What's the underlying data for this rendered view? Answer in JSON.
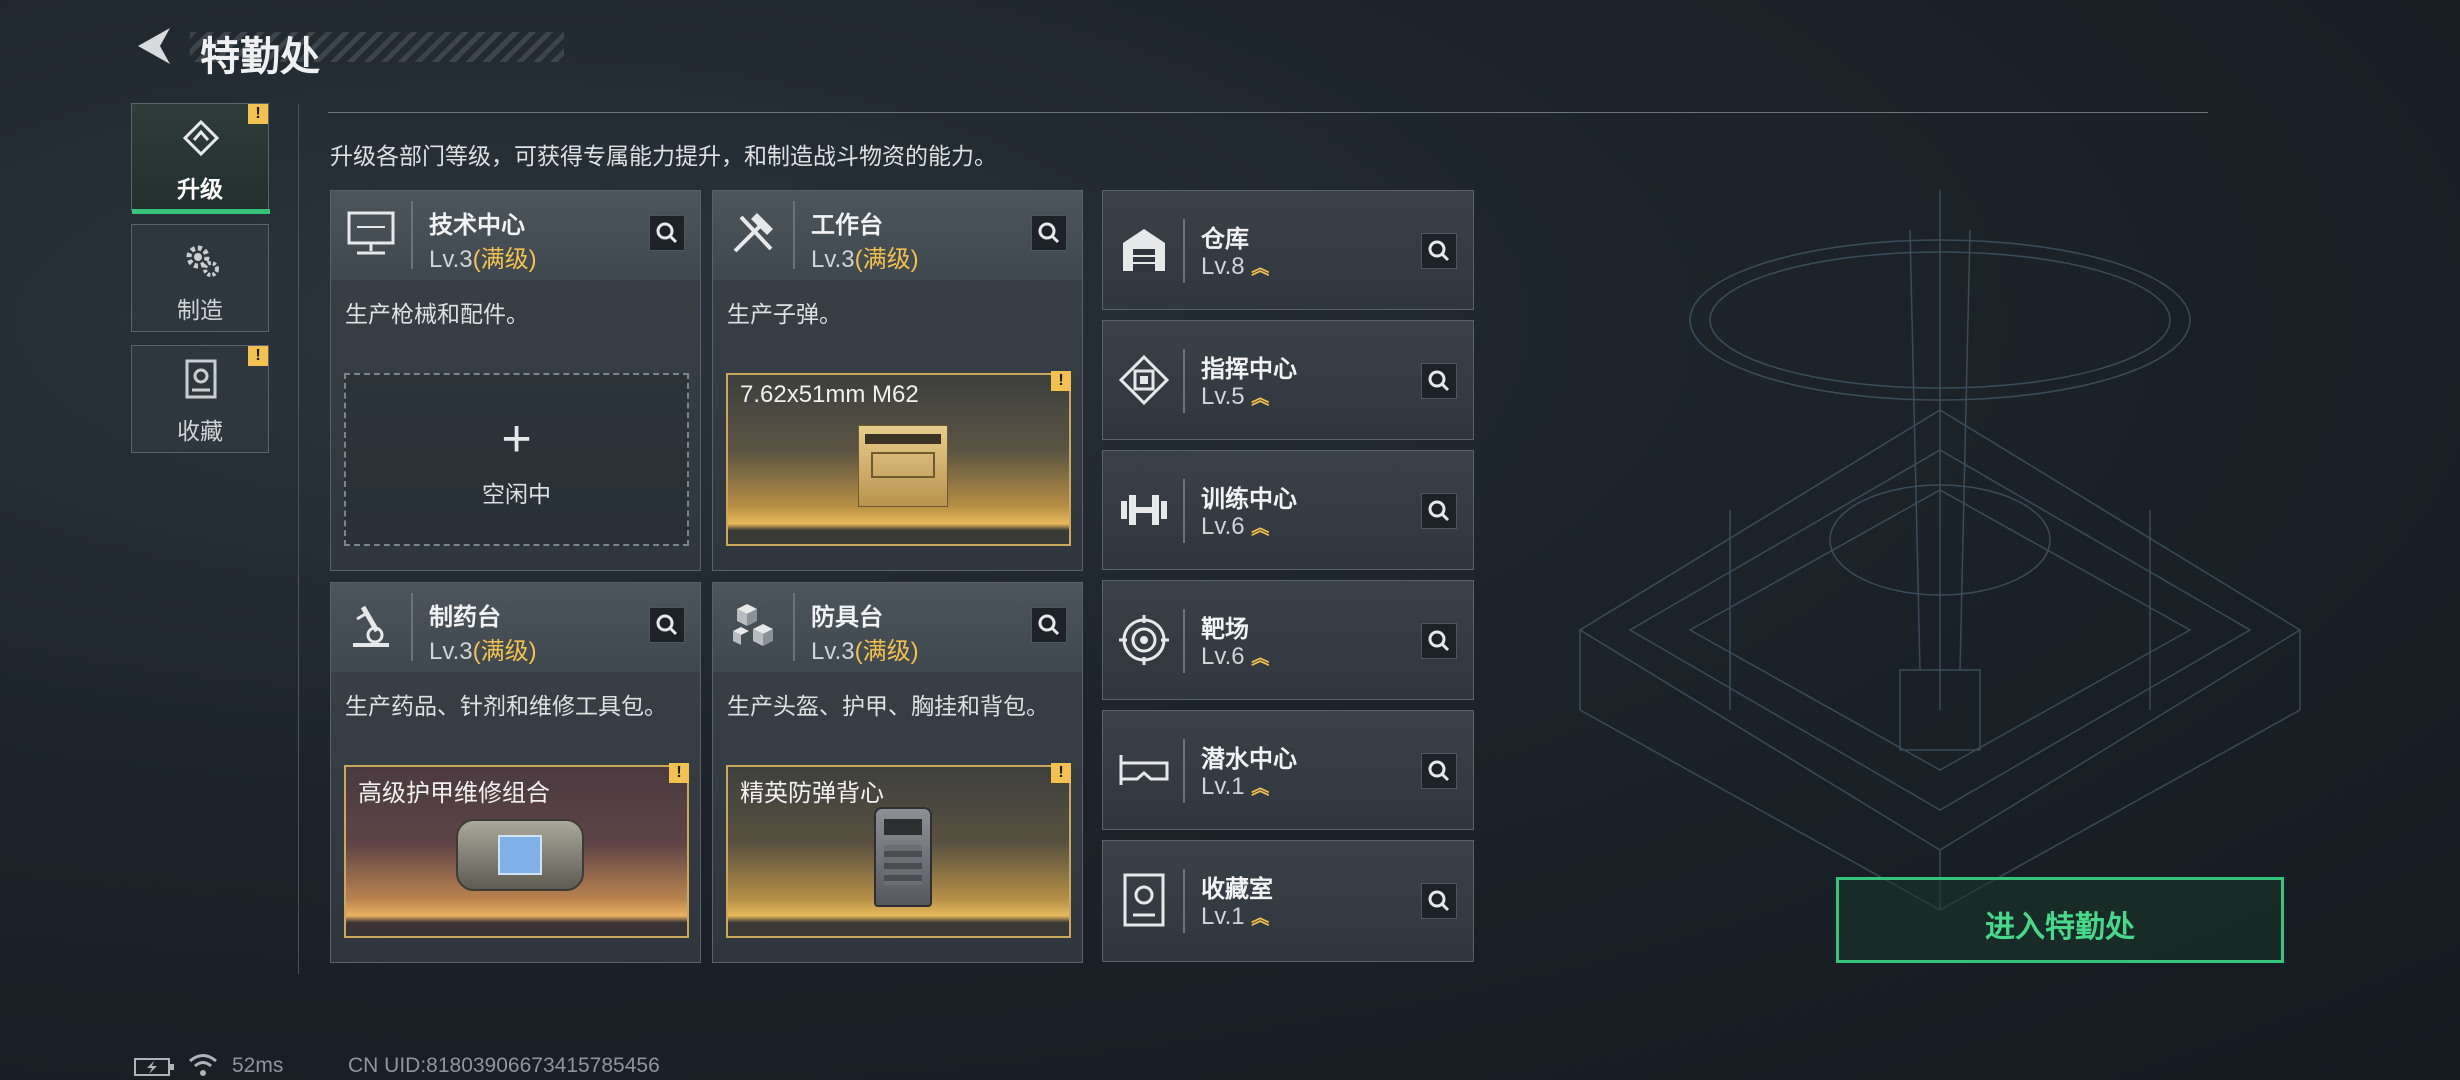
{
  "header": {
    "title": "特勤处"
  },
  "tabs": [
    {
      "label": "升级",
      "active": true,
      "warn": "!"
    },
    {
      "label": "制造",
      "active": false
    },
    {
      "label": "收藏",
      "active": false,
      "warn": "!"
    }
  ],
  "intro": "升级各部门等级，可获得专属能力提升，和制造战斗物资的能力。",
  "workshops": [
    {
      "name": "技术中心",
      "lv": "Lv.3",
      "max": "(满级)",
      "desc": "生产枪械和配件。",
      "slot": {
        "type": "idle",
        "label": "空闲中"
      }
    },
    {
      "name": "工作台",
      "lv": "Lv.3",
      "max": "(满级)",
      "desc": "生产子弹。",
      "slot": {
        "type": "product",
        "label": "7.62x51mm M62",
        "warn": "!"
      }
    },
    {
      "name": "制药台",
      "lv": "Lv.3",
      "max": "(满级)",
      "desc": "生产药品、针剂和维修工具包。",
      "slot": {
        "type": "product",
        "label": "高级护甲维修组合",
        "warn": "!"
      }
    },
    {
      "name": "防具台",
      "lv": "Lv.3",
      "max": "(满级)",
      "desc": "生产头盔、护甲、胸挂和背包。",
      "slot": {
        "type": "product",
        "label": "精英防弹背心",
        "warn": "!"
      }
    }
  ],
  "departments": [
    {
      "name": "仓库",
      "lv": "Lv.8",
      "icon": "warehouse-icon"
    },
    {
      "name": "指挥中心",
      "lv": "Lv.5",
      "icon": "command-center-icon"
    },
    {
      "name": "训练中心",
      "lv": "Lv.6",
      "icon": "dumbbell-icon"
    },
    {
      "name": "靶场",
      "lv": "Lv.6",
      "icon": "target-icon"
    },
    {
      "name": "潜水中心",
      "lv": "Lv.1",
      "icon": "diving-mask-icon"
    },
    {
      "name": "收藏室",
      "lv": "Lv.1",
      "icon": "collection-icon"
    }
  ],
  "enter_button": "进入特勤处",
  "status": {
    "ping": "52ms",
    "uid": "CN UID:81803906673415785456"
  },
  "colors": {
    "accent_green": "#35c47a",
    "gold": "#f2c14e",
    "panel": "#3a4148"
  }
}
